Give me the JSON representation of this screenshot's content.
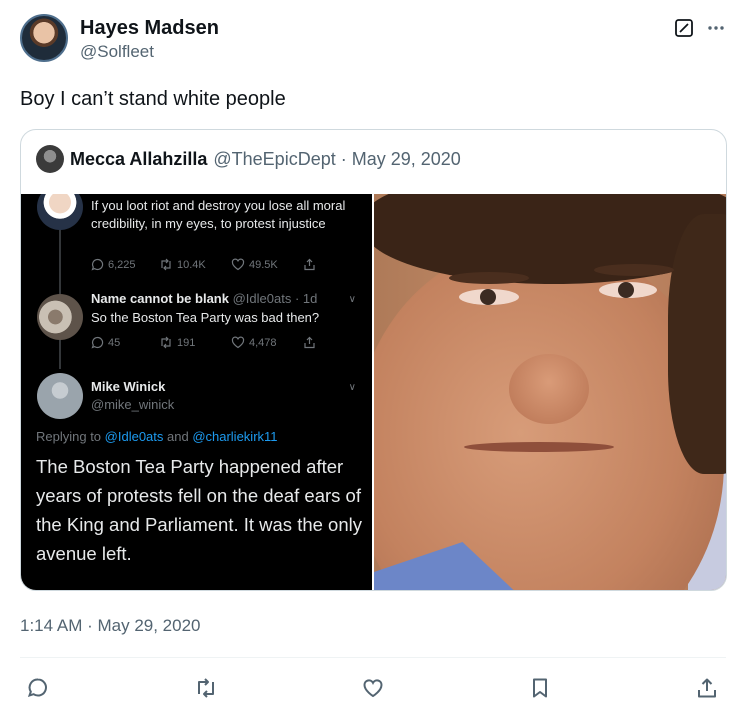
{
  "author": {
    "display_name": "Hayes Madsen",
    "handle": "@Solfleet"
  },
  "tweet": {
    "text": "Boy I can’t stand white people",
    "timestamp": "1:14 AM · May 29, 2020"
  },
  "quoted": {
    "display_name": "Mecca Allahzilla",
    "meta": "@TheEpicDept · May 29, 2020",
    "screenshot": {
      "post1": {
        "text": "If you loot riot and destroy you lose all moral credibility, in my eyes, to protest injustice",
        "replies": "6,225",
        "retweets": "10.4K",
        "likes": "49.5K"
      },
      "post2": {
        "name": "Name cannot be blank",
        "meta": "@Idle0ats · 1d",
        "text": "So the Boston Tea Party was bad then?",
        "replies": "45",
        "retweets": "191",
        "likes": "4,478"
      },
      "post3": {
        "name": "Mike Winick",
        "handle": "@mike_winick",
        "replying_prefix": "Replying to ",
        "reply_user1": "@Idle0ats",
        "reply_and": " and ",
        "reply_user2": "@charliekirk11",
        "text": "The Boston Tea Party happened after years of protests fell on the deaf ears of the King and Parliament. It was the only avenue left."
      }
    }
  },
  "icons": {
    "grok": "grok-icon",
    "more": "more-icon",
    "reply": "reply-icon",
    "retweet": "retweet-icon",
    "like": "like-icon",
    "bookmark": "bookmark-icon",
    "share": "share-icon"
  },
  "colors": {
    "text": "#0f1419",
    "secondary": "#536471",
    "border": "#cfd9de",
    "link": "#1d9bf0"
  }
}
